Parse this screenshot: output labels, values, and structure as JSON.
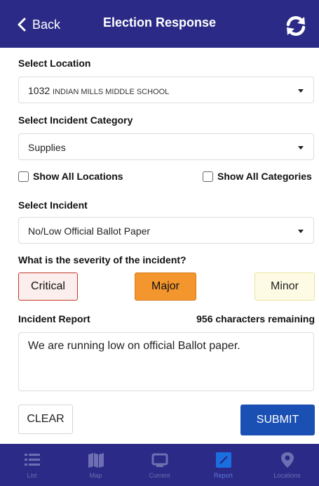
{
  "header": {
    "back_label": "Back",
    "title": "Election Response"
  },
  "location": {
    "label": "Select Location",
    "value_number": "1032",
    "value_name": "INDIAN MILLS MIDDLE SCHOOL"
  },
  "category": {
    "label": "Select Incident Category",
    "value": "Supplies"
  },
  "filters": {
    "show_all_locations": "Show All Locations",
    "show_all_categories": "Show All Categories"
  },
  "incident": {
    "label": "Select Incident",
    "value": "No/Low Official Ballot Paper"
  },
  "severity": {
    "question": "What is the severity of the incident?",
    "critical": "Critical",
    "major": "Major",
    "minor": "Minor",
    "selected": "Major"
  },
  "report": {
    "label": "Incident Report",
    "chars_remaining": "956 characters remaining",
    "text": "We are running low on official Ballot paper."
  },
  "actions": {
    "clear": "CLEAR",
    "submit": "SUBMIT"
  },
  "tabs": [
    {
      "label": "List",
      "icon": "list-icon"
    },
    {
      "label": "Map",
      "icon": "map-icon"
    },
    {
      "label": "Current",
      "icon": "monitor-icon"
    },
    {
      "label": "Report",
      "icon": "edit-icon"
    },
    {
      "label": "Locations",
      "icon": "location-pin-icon"
    }
  ],
  "colors": {
    "header_bg": "#2b2a86",
    "submit_bg": "#1a4fb4",
    "major_bg": "#f2962d",
    "critical_border": "#c0392b",
    "minor_bg": "#fdfbe4"
  }
}
